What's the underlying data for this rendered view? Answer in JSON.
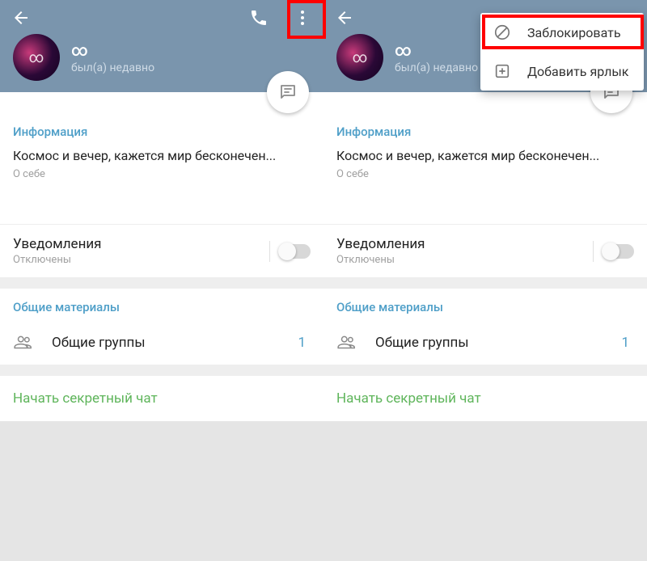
{
  "left": {
    "profile_name": "∞",
    "profile_status": "был(а) недавно",
    "info_title": "Информация",
    "bio": "Космос и вечер, кажется мир бесконечен...",
    "bio_label": "О себе",
    "notifications_label": "Уведомления",
    "notifications_status": "Отключены",
    "shared_title": "Общие материалы",
    "groups_label": "Общие группы",
    "groups_count": "1",
    "secret_chat": "Начать секретный чат"
  },
  "right": {
    "profile_name": "∞",
    "profile_status": "был(а) недавно",
    "info_title": "Информация",
    "bio": "Космос и вечер, кажется мир бесконечен...",
    "bio_label": "О себе",
    "notifications_label": "Уведомления",
    "notifications_status": "Отключены",
    "shared_title": "Общие материалы",
    "groups_label": "Общие группы",
    "groups_count": "1",
    "secret_chat": "Начать секретный чат",
    "menu": {
      "block": "Заблокировать",
      "shortcut": "Добавить ярлык"
    }
  }
}
